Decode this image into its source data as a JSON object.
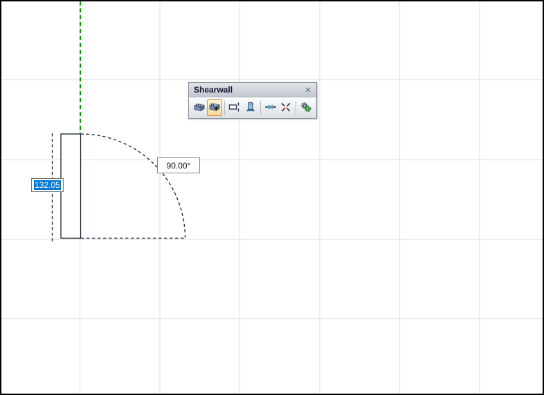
{
  "window": {
    "title": "Shearwall",
    "close_label": "×"
  },
  "toolbar": {
    "buttons": [
      {
        "name": "draw-shearwall",
        "icon": "wall-icon",
        "active": false
      },
      {
        "name": "add-shearwall",
        "icon": "wall-add-icon",
        "active": true
      },
      {
        "name": "wall-thickness",
        "icon": "wall-thickness-icon",
        "active": false
      },
      {
        "name": "pedestal",
        "icon": "pedestal-icon",
        "active": false
      },
      {
        "name": "snap-axis",
        "icon": "snap-axis-icon",
        "active": false
      },
      {
        "name": "break-node",
        "icon": "break-node-icon",
        "active": false
      },
      {
        "name": "settings",
        "icon": "gears-icon",
        "active": false
      }
    ]
  },
  "drawing": {
    "dimension_input": {
      "value": "132.05",
      "selection_color": "#0078d7"
    },
    "angle_label": {
      "value": "90.00°"
    },
    "guide_line_color": "#00a000",
    "grid_color": "#e3e3ea",
    "outline_color": "#1a202c"
  }
}
